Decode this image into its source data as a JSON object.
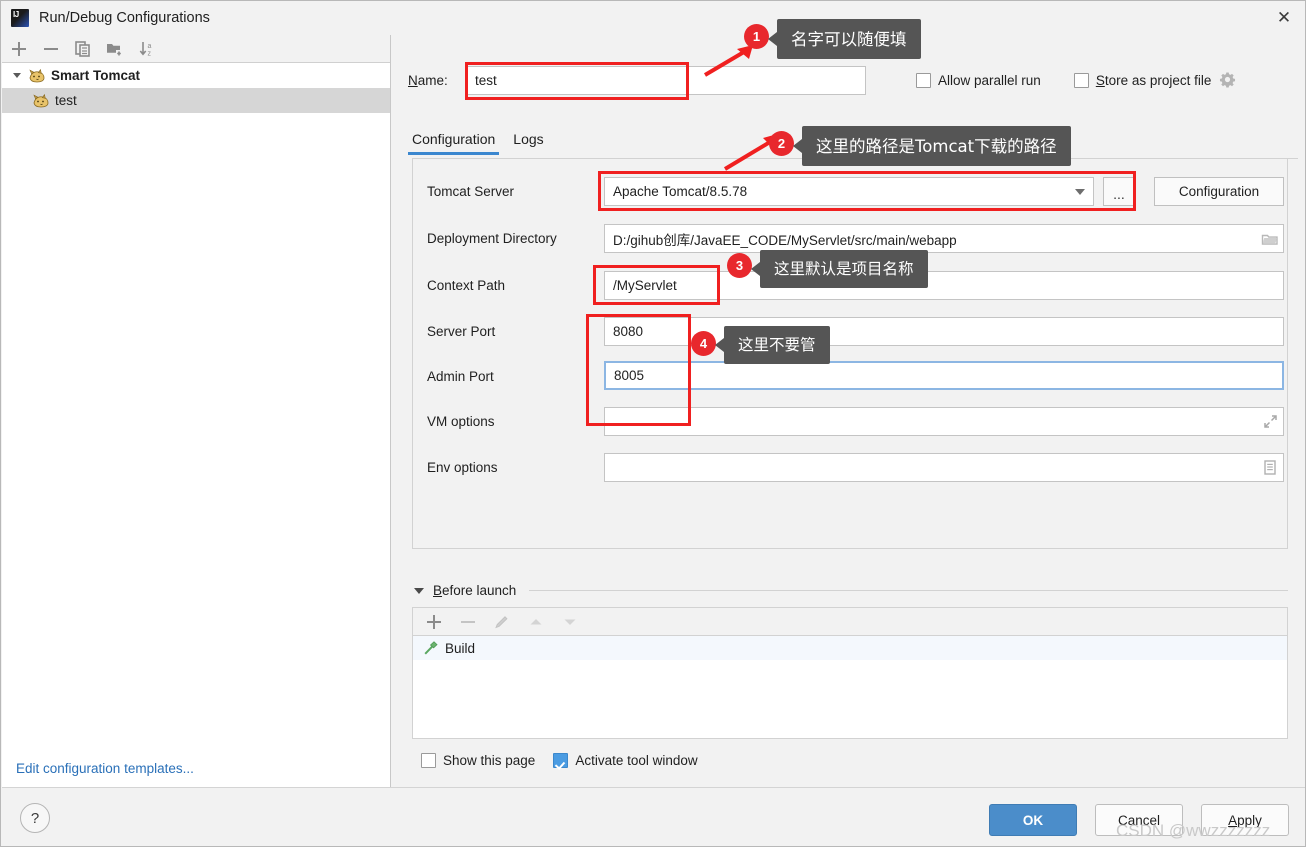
{
  "window": {
    "title": "Run/Debug Configurations",
    "logo_icon": "intellij-idea-logo-icon",
    "close_icon": "close-icon"
  },
  "left_panel": {
    "toolbar": [
      {
        "name": "add-configuration-button",
        "icon": "plus-icon"
      },
      {
        "name": "remove-configuration-button",
        "icon": "minus-icon"
      },
      {
        "name": "copy-configuration-button",
        "icon": "copy-icon"
      },
      {
        "name": "new-folder-button",
        "icon": "folder-add-icon"
      },
      {
        "name": "sort-configurations-button",
        "icon": "sort-alphabetical-icon"
      }
    ],
    "tree": [
      {
        "label": "Smart Tomcat",
        "icon": "tomcat-cat-icon",
        "group": true,
        "expanded": true,
        "selected": false
      },
      {
        "label": "test",
        "icon": "tomcat-cat-icon",
        "group": false,
        "selected": true
      }
    ],
    "footer_link": "Edit configuration templates..."
  },
  "name_row": {
    "label": "Name:",
    "label_mnemonic": "N",
    "value": "test",
    "allow_parallel_run": {
      "label": "Allow parallel run",
      "checked": false
    },
    "store_as_project_file": {
      "label": "Store as project file",
      "label_mnemonic": "S",
      "checked": false
    },
    "gear_icon": "gear-dropdown-icon"
  },
  "tabs": [
    {
      "label": "Configuration",
      "active": true
    },
    {
      "label": "Logs",
      "active": false
    }
  ],
  "config_fields": [
    {
      "name": "tomcat-server",
      "label": "Tomcat Server",
      "value": "Apache Tomcat/8.5.78",
      "control": "combobox",
      "trailing_button": "...",
      "side_button": "Configuration",
      "focused": false
    },
    {
      "name": "deployment-directory",
      "label": "Deployment Directory",
      "value": "D:/gihub创库/JavaEE_CODE/MyServlet/src/main/webapp",
      "control": "text-with-browse",
      "icon": "folder-browse-icon",
      "focused": false
    },
    {
      "name": "context-path",
      "label": "Context Path",
      "value": "/MyServlet",
      "control": "text",
      "focused": false
    },
    {
      "name": "server-port",
      "label": "Server Port",
      "value": "8080",
      "control": "text",
      "focused": false
    },
    {
      "name": "admin-port",
      "label": "Admin Port",
      "value": "8005",
      "control": "text",
      "focused": true
    },
    {
      "name": "vm-options",
      "label": "VM options",
      "value": "",
      "control": "text-with-expand",
      "icon": "expand-diagonal-icon",
      "focused": false
    },
    {
      "name": "env-options",
      "label": "Env options",
      "value": "",
      "control": "text-with-editor",
      "icon": "document-edit-icon",
      "focused": false
    }
  ],
  "before_launch": {
    "title": "Before launch",
    "title_mnemonic": "B",
    "expanded": true,
    "toolbar": [
      {
        "name": "add-task-button",
        "icon": "plus-icon",
        "enabled": true
      },
      {
        "name": "remove-task-button",
        "icon": "minus-icon",
        "enabled": false
      },
      {
        "name": "edit-task-button",
        "icon": "pencil-icon",
        "enabled": false
      },
      {
        "name": "move-up-button",
        "icon": "arrow-up-icon",
        "enabled": false
      },
      {
        "name": "move-down-button",
        "icon": "arrow-down-icon",
        "enabled": false
      }
    ],
    "items": [
      {
        "label": "Build",
        "icon": "hammer-icon"
      }
    ]
  },
  "bottom_checks": [
    {
      "name": "show-this-page-checkbox",
      "label": "Show this page",
      "checked": false
    },
    {
      "name": "activate-tool-window-checkbox",
      "label": "Activate tool window",
      "checked": true
    }
  ],
  "footer": {
    "help_icon": "question-mark-icon",
    "buttons": [
      {
        "name": "ok-button",
        "label": "OK",
        "style": "primary"
      },
      {
        "name": "cancel-button",
        "label": "Cancel",
        "style": "default"
      },
      {
        "name": "apply-button",
        "label": "Apply",
        "style": "default",
        "mnemonic": "A"
      }
    ]
  },
  "annotations": {
    "accent_color": "#e8282d",
    "tooltip_bg": "#555555",
    "items": [
      {
        "badge": "1",
        "text": "名字可以随便填"
      },
      {
        "badge": "2",
        "text": "这里的路径是Tomcat下载的路径"
      },
      {
        "badge": "3",
        "text": "这里默认是项目名称"
      },
      {
        "badge": "4",
        "text": "这里不要管"
      }
    ]
  },
  "watermark": "CSDN @wwzzzzzzz"
}
